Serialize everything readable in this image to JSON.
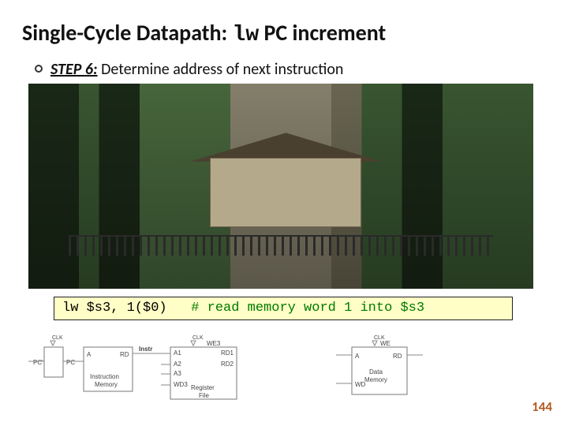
{
  "title_prefix": "Single-Cycle Datapath: ",
  "title_mono": "lw",
  "title_suffix": " PC increment",
  "step": {
    "label": "STEP 6:",
    "text": " Determine address of next instruction"
  },
  "code": {
    "instr": "lw $s3, 1($0)",
    "gap": "   ",
    "comment": "# read memory word 1 into $s3"
  },
  "diagram": {
    "clk": "CLK",
    "pc_left": "PC'",
    "pc": "PC",
    "a": "A",
    "rd": "RD",
    "instr_mem": "Instruction",
    "instr_mem2": "Memory",
    "instr": "Instr",
    "a1": "A1",
    "a2": "A2",
    "a3": "A3",
    "wd3": "WD3",
    "rd1": "RD1",
    "rd2": "RD2",
    "we3": "WE3",
    "regfile": "Register",
    "regfile2": "File",
    "we": "WE",
    "datamem": "Data",
    "datamem2": "Memory",
    "wd": "WD"
  },
  "page": "144"
}
